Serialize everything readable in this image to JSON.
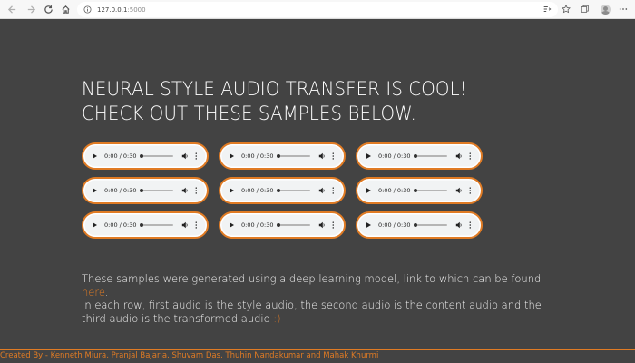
{
  "browser": {
    "url_host": "127.0.0.1",
    "url_port": ":5000"
  },
  "page": {
    "title_line1": "NEURAL STYLE AUDIO TRANSFER IS COOL!",
    "title_line2": "CHECK OUT THESE SAMPLES BELOW.",
    "audio_players": [
      {
        "time": "0:00 / 0:30"
      },
      {
        "time": "0:00 / 0:30"
      },
      {
        "time": "0:00 / 0:30"
      },
      {
        "time": "0:00 / 0:30"
      },
      {
        "time": "0:00 / 0:30"
      },
      {
        "time": "0:00 / 0:30"
      },
      {
        "time": "0:00 / 0:30"
      },
      {
        "time": "0:00 / 0:30"
      },
      {
        "time": "0:00 / 0:30"
      }
    ],
    "paragraph1_text": "These samples were generated using a deep learning model, link to which can be found ",
    "paragraph1_link": "here",
    "paragraph1_end": ".",
    "paragraph2_text": "In each row, first audio is the style audio, the second audio is the content audio and the third audio is the transformed audio ",
    "paragraph2_smiley": ":)",
    "footer": "Created By - Kenneth Miura, Pranjal Bajaria, Shuvam Das, Thuhin Nandakumar and Mahak Khurmi"
  },
  "colors": {
    "accent": "#e07b24",
    "background": "#434343"
  },
  "icons": [
    "back-arrow-icon",
    "forward-arrow-icon",
    "reload-icon",
    "home-icon",
    "info-icon",
    "read-aloud-icon",
    "favorite-star-icon",
    "collections-icon",
    "favorites-icon",
    "profile-avatar-icon",
    "more-icon",
    "play-icon",
    "volume-icon",
    "more-vertical-icon"
  ]
}
